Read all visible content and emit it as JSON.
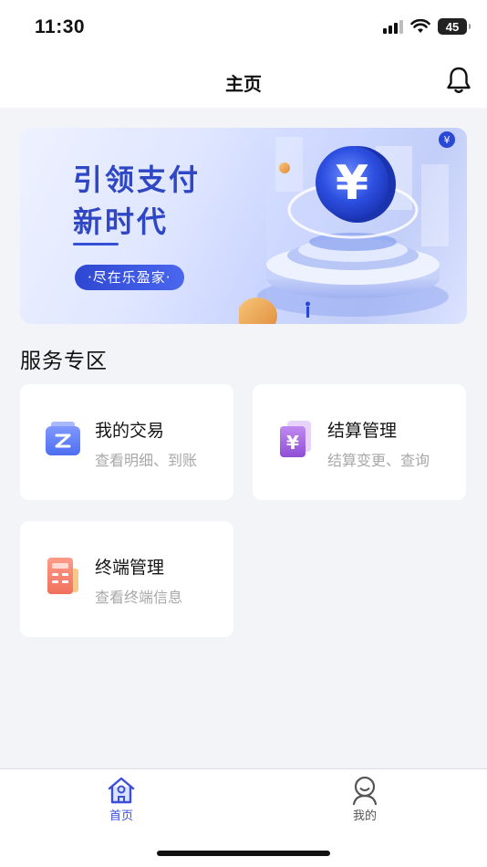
{
  "status_bar": {
    "time": "11:30",
    "battery": "45"
  },
  "nav": {
    "title": "主页"
  },
  "banner": {
    "line1": "引领支付",
    "line2": "新时代",
    "pill": "·尽在乐盈家·"
  },
  "section": {
    "title": "服务专区"
  },
  "cards": [
    {
      "title": "我的交易",
      "subtitle": "查看明细、到账",
      "icon": "transaction-icon"
    },
    {
      "title": "结算管理",
      "subtitle": "结算变更、查询",
      "icon": "settlement-icon"
    },
    {
      "title": "终端管理",
      "subtitle": "查看终端信息",
      "icon": "terminal-icon"
    }
  ],
  "tabs": [
    {
      "label": "首页",
      "icon": "home-icon",
      "active": true
    },
    {
      "label": "我的",
      "icon": "profile-icon",
      "active": false
    }
  ],
  "colors": {
    "accent": "#3a4fd8",
    "banner_text": "#2f47c4",
    "background": "#f3f4f8"
  }
}
